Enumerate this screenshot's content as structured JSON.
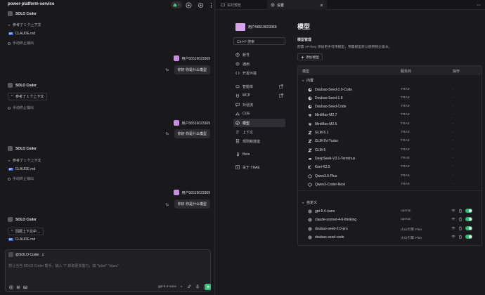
{
  "left": {
    "project": "power-platform-service",
    "task_count": "1",
    "blocks": [
      {
        "bot": "SOLO Coder",
        "ctx": "参考了 1 个上下文",
        "file": "CLAUDE.md",
        "stop": "手动终止输出"
      },
      {
        "bot": "SOLO Coder",
        "ctx": "参考了 1 个上下文",
        "file": "CLAUDE.md",
        "stop": "手动终止输出"
      },
      {
        "bot": "SOLO Coder",
        "ctx": "参考了 1 个上下文",
        "file": "CLAUDE.md",
        "stop": "手动终止输出"
      },
      {
        "bot": "SOLO Coder",
        "ctx": "回顾上下文中 ...",
        "file": "CLAUDE.md"
      }
    ],
    "user_name": "用户56519023369",
    "user_msg": "你好 你是什么模型",
    "file_tag": "EF",
    "input": {
      "agent": "@SOLO Coder",
      "placeholder": "想让当当 SOLO Coder 帮手。输入 \"/\" 获取更多能力，如 \"/plan\" \"/spec\"",
      "model": "gpt-5.4-nano"
    }
  },
  "right": {
    "tabs": [
      "实时预览",
      "设置"
    ],
    "profile_name": "用户56519023369",
    "search": "Ctrl+F 搜索",
    "nav": [
      {
        "label": "账号",
        "icon": "user-icon"
      },
      {
        "label": "通用",
        "icon": "gear-icon"
      },
      {
        "label": "开发环境",
        "icon": "code-icon"
      },
      {
        "label": "智能体",
        "icon": "bot-icon",
        "ext": true
      },
      {
        "label": "MCP",
        "icon": "plug-icon",
        "ext": true
      },
      {
        "label": "对话流",
        "icon": "chat-icon"
      },
      {
        "label": "CUE",
        "icon": "cue-icon"
      },
      {
        "label": "模型",
        "icon": "model-icon",
        "active": true
      },
      {
        "label": "上下文",
        "icon": "context-icon"
      },
      {
        "label": "规则和技能",
        "icon": "rules-icon"
      },
      {
        "label": "Beta",
        "icon": "beta-icon"
      },
      {
        "label": "关于 TRAE",
        "icon": "info-icon"
      }
    ],
    "title": "模型",
    "subtitle": "模型管理",
    "desc": "配置 API key 添加更多可用模型，预置模型默认使用物企版本。",
    "add_button": "添加模型",
    "columns": [
      "模型",
      "服务商",
      "操作"
    ],
    "groups": [
      {
        "label": "内置",
        "rows": [
          {
            "name": "Doubao-Seed-2.0-Code",
            "provider": "TRAE",
            "op": "-",
            "icon": "doubao-icon"
          },
          {
            "name": "Doubao-Seed-1.8",
            "provider": "TRAE",
            "op": "-",
            "icon": "doubao-icon"
          },
          {
            "name": "Doubao-Seed-Code",
            "provider": "TRAE",
            "op": "-",
            "icon": "doubao-icon"
          },
          {
            "name": "MiniMax-M2.7",
            "provider": "TRAE",
            "op": "-",
            "icon": "minimax-icon"
          },
          {
            "name": "MiniMax-M2.5",
            "provider": "TRAE",
            "op": "-",
            "icon": "minimax-icon"
          },
          {
            "name": "GLM-5.1",
            "provider": "TRAE",
            "op": "-",
            "icon": "glm-icon"
          },
          {
            "name": "GLM-5V-Turbo",
            "provider": "TRAE",
            "op": "-",
            "icon": "glm-icon"
          },
          {
            "name": "GLM-5",
            "provider": "TRAE",
            "op": "-",
            "icon": "glm-icon"
          },
          {
            "name": "DeepSeek-V3.1-Terminus",
            "provider": "TRAE",
            "op": "-",
            "icon": "deepseek-icon"
          },
          {
            "name": "Kimi-K2.5",
            "provider": "TRAE",
            "op": "-",
            "icon": "kimi-icon"
          },
          {
            "name": "Qwen3.5-Plus",
            "provider": "TRAE",
            "op": "-",
            "icon": "qwen-icon"
          },
          {
            "name": "Qwen3-Coder-Next",
            "provider": "TRAE",
            "op": "-",
            "icon": "qwen-icon"
          }
        ]
      },
      {
        "label": "自定义",
        "rows": [
          {
            "name": "gpt-5.4-nano",
            "provider": "openai",
            "icon": "openai-icon",
            "toggle": true
          },
          {
            "name": "claude-sonnet-4-6-thinking",
            "provider": "openai",
            "icon": "openai-icon",
            "toggle": true
          },
          {
            "name": "doubao-seed-2.0-pro",
            "provider": "火山引擎 Plan",
            "icon": "openai-icon",
            "toggle": true
          },
          {
            "name": "doubao-seed-code",
            "provider": "火山引擎 Plan",
            "icon": "openai-icon",
            "toggle": true
          }
        ]
      }
    ]
  }
}
